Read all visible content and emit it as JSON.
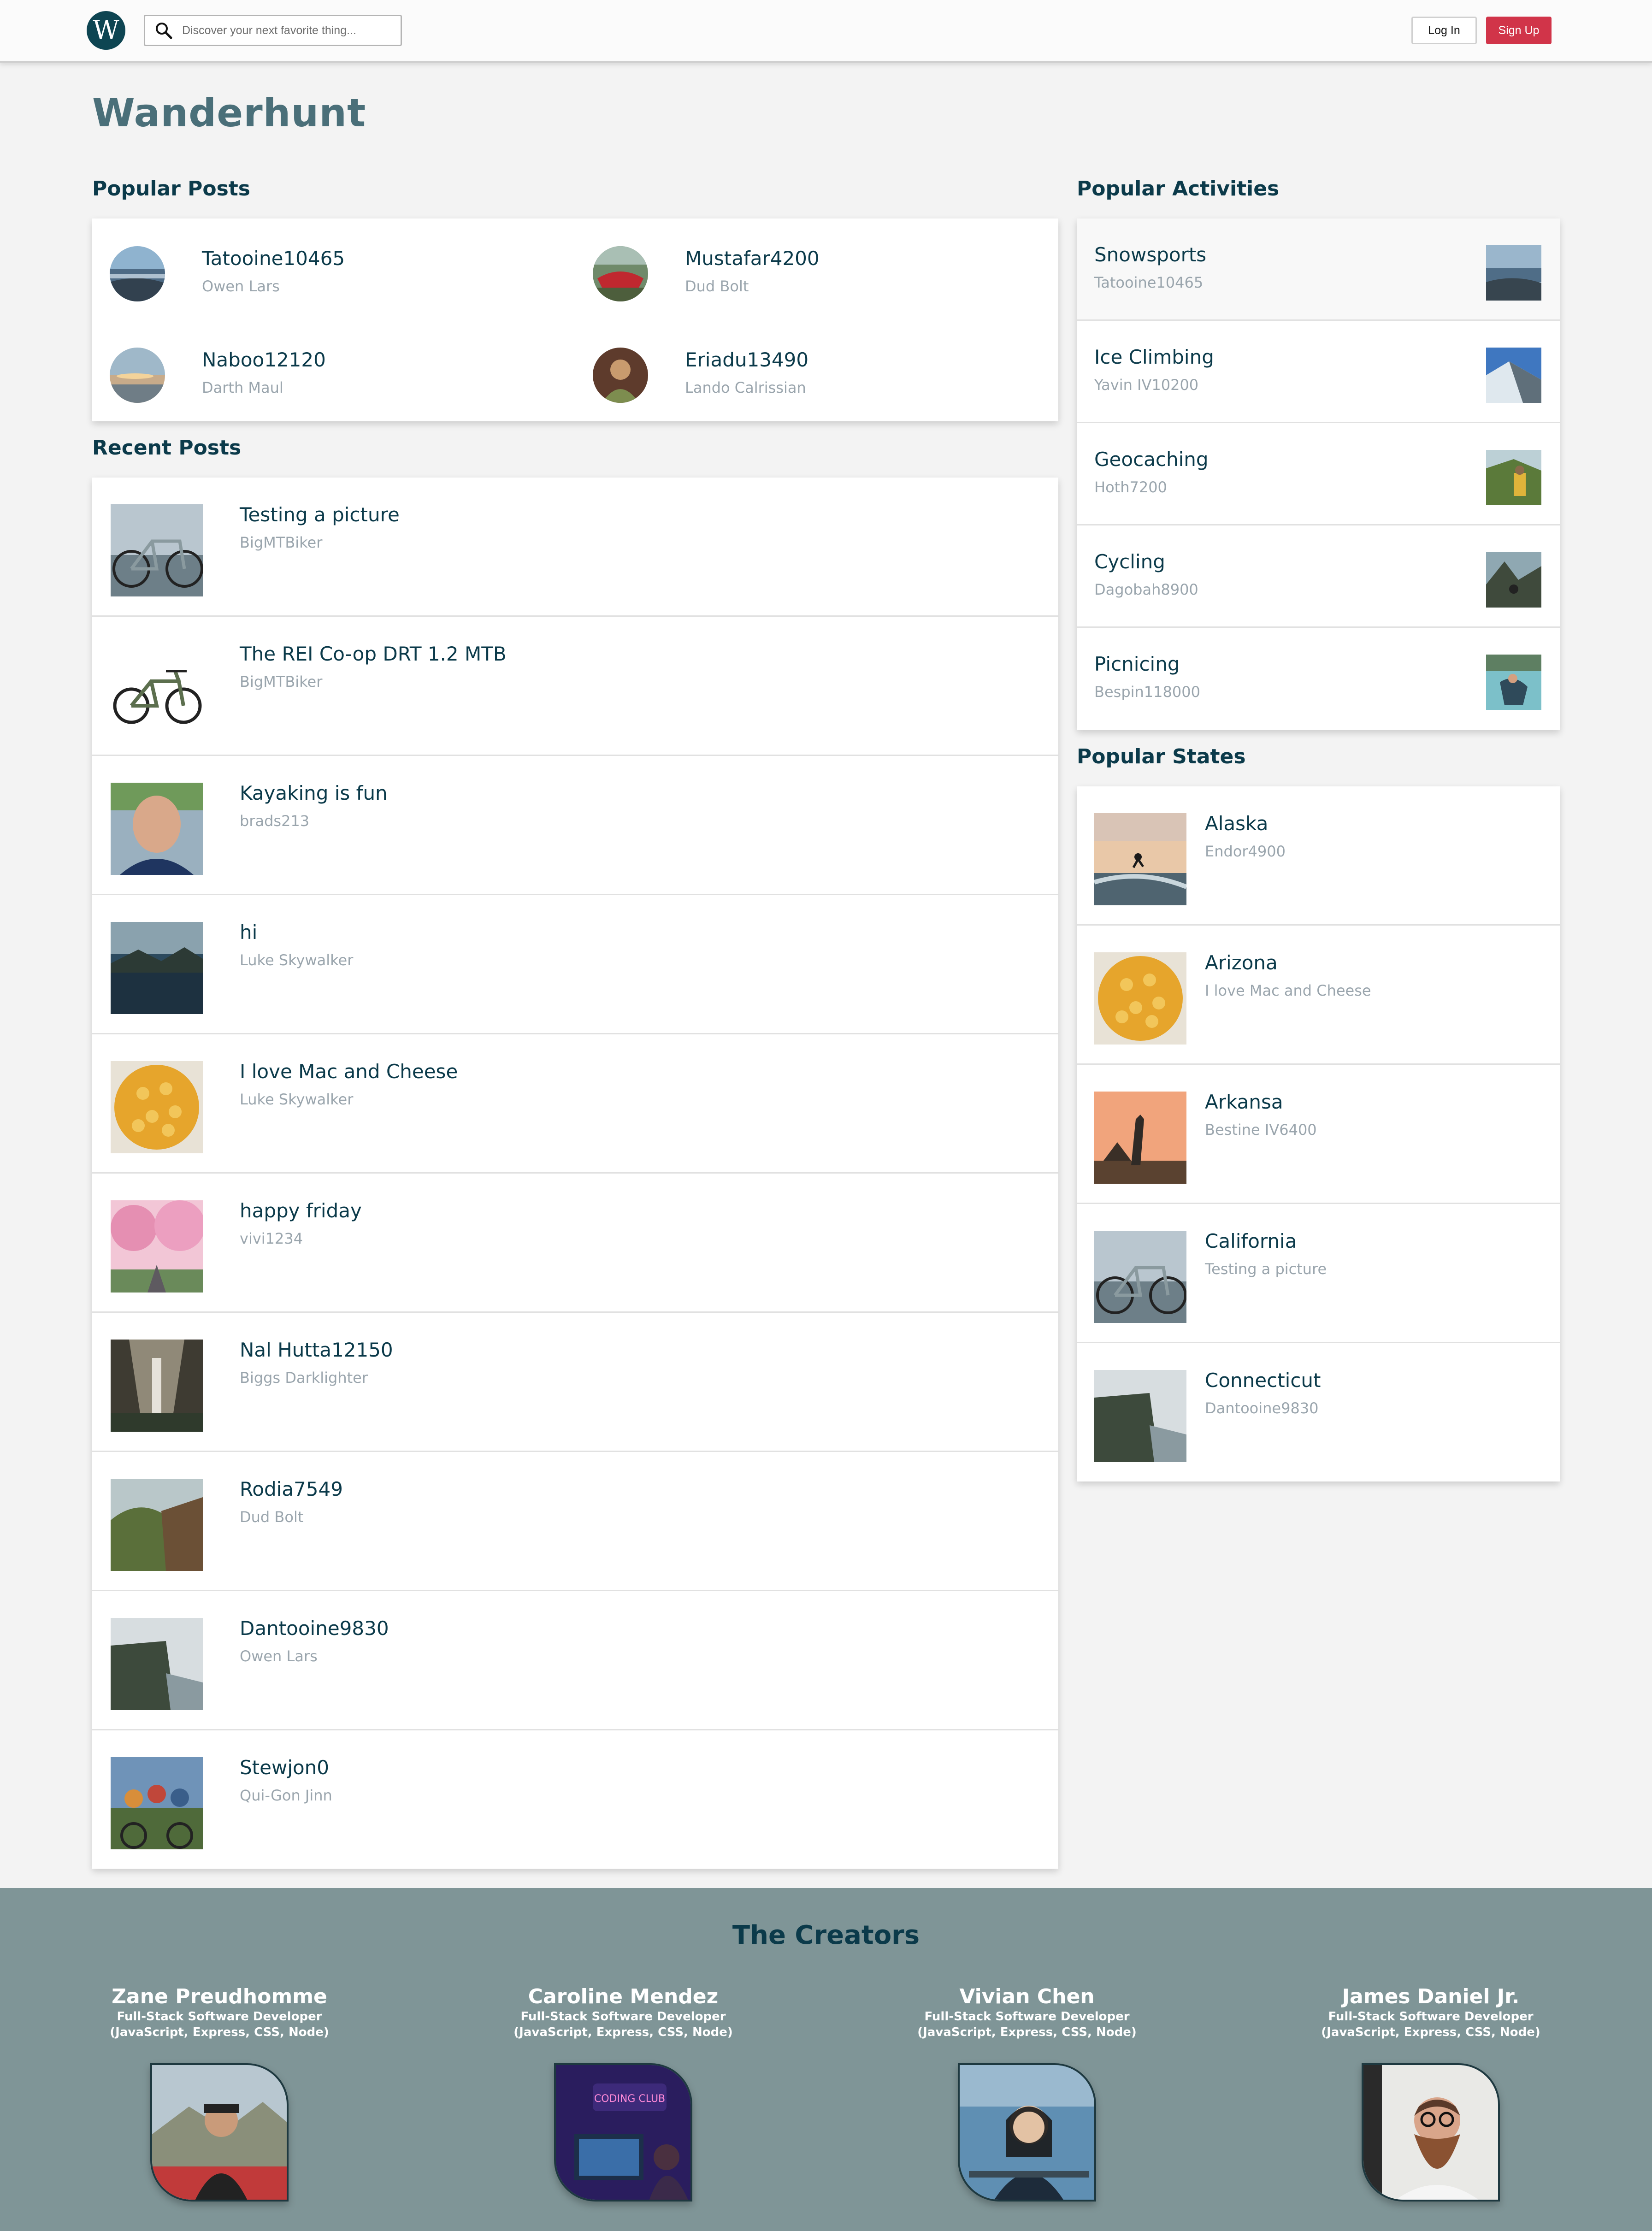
{
  "header": {
    "logo_letter": "W",
    "search_placeholder": "Discover your next favorite thing...",
    "login_label": "Log In",
    "signup_label": "Sign Up"
  },
  "site_title": "Wanderhunt",
  "popular_posts": {
    "heading": "Popular Posts",
    "items": [
      {
        "title": "Tatooine10465",
        "author": "Owen Lars"
      },
      {
        "title": "Mustafar4200",
        "author": "Dud Bolt"
      },
      {
        "title": "Naboo12120",
        "author": "Darth Maul"
      },
      {
        "title": "Eriadu13490",
        "author": "Lando Calrissian"
      }
    ]
  },
  "recent_posts": {
    "heading": "Recent Posts",
    "items": [
      {
        "title": "Testing a picture",
        "author": "BigMTBiker"
      },
      {
        "title": "The REI Co-op DRT 1.2 MTB",
        "author": "BigMTBiker"
      },
      {
        "title": "Kayaking is fun",
        "author": "brads213"
      },
      {
        "title": "hi",
        "author": "Luke Skywalker"
      },
      {
        "title": "I love Mac and Cheese",
        "author": "Luke Skywalker"
      },
      {
        "title": "happy friday",
        "author": "vivi1234"
      },
      {
        "title": "Nal Hutta12150",
        "author": "Biggs Darklighter"
      },
      {
        "title": "Rodia7549",
        "author": "Dud Bolt"
      },
      {
        "title": "Dantooine9830",
        "author": "Owen Lars"
      },
      {
        "title": "Stewjon0",
        "author": "Qui-Gon Jinn"
      }
    ]
  },
  "popular_activities": {
    "heading": "Popular Activities",
    "items": [
      {
        "title": "Snowsports",
        "sub": "Tatooine10465"
      },
      {
        "title": "Ice Climbing",
        "sub": "Yavin IV10200"
      },
      {
        "title": "Geocaching",
        "sub": "Hoth7200"
      },
      {
        "title": "Cycling",
        "sub": "Dagobah8900"
      },
      {
        "title": "Picnicing",
        "sub": "Bespin118000"
      }
    ]
  },
  "popular_states": {
    "heading": "Popular States",
    "items": [
      {
        "title": "Alaska",
        "sub": "Endor4900"
      },
      {
        "title": "Arizona",
        "sub": "I love Mac and Cheese"
      },
      {
        "title": "Arkansa",
        "sub": "Bestine IV6400"
      },
      {
        "title": "California",
        "sub": "Testing a picture"
      },
      {
        "title": "Connecticut",
        "sub": "Dantooine9830"
      }
    ]
  },
  "footer": {
    "title": "The Creators",
    "creators": [
      {
        "name": "Zane Preudhomme",
        "role_line1": "Full-Stack Software Developer",
        "role_line2": "(JavaScript, Express, CSS, Node)"
      },
      {
        "name": "Caroline Mendez",
        "role_line1": "Full-Stack Software Developer",
        "role_line2": "(JavaScript, Express, CSS, Node)"
      },
      {
        "name": "Vivian Chen",
        "role_line1": "Full-Stack Software Developer",
        "role_line2": "(JavaScript, Express, CSS, Node)"
      },
      {
        "name": "James Daniel Jr.",
        "role_line1": "Full-Stack Software Developer",
        "role_line2": "(JavaScript, Express, CSS, Node)"
      }
    ],
    "sign_text": "CODING CLUB"
  },
  "colors": {
    "brand_dark": "#0e4552",
    "signup_red": "#d13449",
    "title_slate": "#4a6f79",
    "footer_bg": "#7f9597"
  }
}
